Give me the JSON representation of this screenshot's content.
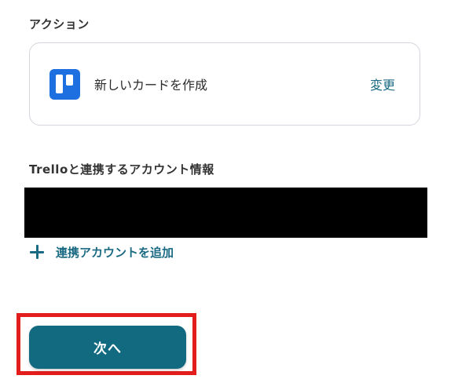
{
  "action_section": {
    "title": "アクション",
    "card": {
      "app_icon": "trello-icon",
      "action_name": "新しいカードを作成",
      "change_label": "変更"
    }
  },
  "account_section": {
    "title": "Trelloと連携するアカウント情報",
    "add_account_label": "連携アカウントを追加",
    "add_icon": "plus-icon"
  },
  "footer": {
    "next_label": "次へ"
  },
  "colors": {
    "accent": "#116a7f",
    "link": "#1a6a83",
    "highlight": "#e31c1c",
    "trello_blue": "#1e6fe0",
    "redaction": "#000000"
  }
}
